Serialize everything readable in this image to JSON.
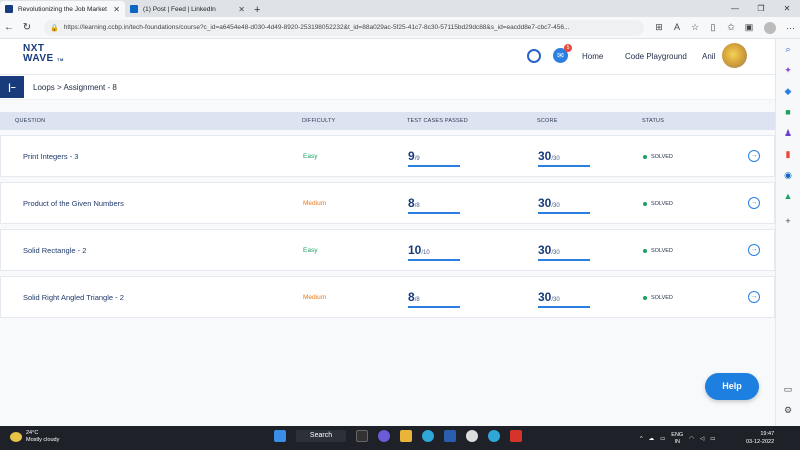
{
  "browser": {
    "tabs": [
      {
        "title": "Revolutionizing the Job Market |",
        "active": true
      },
      {
        "title": "(1) Post | Feed | LinkedIn",
        "active": false
      }
    ],
    "url": "https://learning.ccbp.in/tech-foundations/course?c_id=a6454e48-d030-4d49-8920-253198052232&t_id=88a029ac-5f25-41c7-8c30-57115bd29dc88&s_id=eacdd8e7-cbc7-456..."
  },
  "header": {
    "logo_line1": "NXT",
    "logo_line2": "WAVE",
    "logo_tm": "TM",
    "notification_count": "5",
    "home": "Home",
    "playground": "Code Playground",
    "user": "Anil"
  },
  "breadcrumb": "Loops > Assignment - 8",
  "table": {
    "headers": {
      "question": "QUESTION",
      "difficulty": "DIFFICULTY",
      "tests": "TEST CASES PASSED",
      "score": "SCORE",
      "status": "STATUS"
    },
    "rows": [
      {
        "question": "Print Integers - 3",
        "difficulty": "Easy",
        "diff_color": "#1aa260",
        "tests_passed": "9",
        "tests_total": "/9",
        "score": "30",
        "score_total": "/30",
        "status": "SOLVED"
      },
      {
        "question": "Product of the Given Numbers",
        "difficulty": "Medium",
        "diff_color": "#e67a1c",
        "tests_passed": "8",
        "tests_total": "/8",
        "score": "30",
        "score_total": "/30",
        "status": "SOLVED"
      },
      {
        "question": "Solid Rectangle - 2",
        "difficulty": "Easy",
        "diff_color": "#1aa260",
        "tests_passed": "10",
        "tests_total": "/10",
        "score": "30",
        "score_total": "/30",
        "status": "SOLVED"
      },
      {
        "question": "Solid Right Angled Triangle - 2",
        "difficulty": "Medium",
        "diff_color": "#e67a1c",
        "tests_passed": "8",
        "tests_total": "/8",
        "score": "30",
        "score_total": "/30",
        "status": "SOLVED"
      }
    ]
  },
  "help": "Help",
  "taskbar": {
    "temp": "24°C",
    "weather": "Mostly cloudy",
    "search": "Search",
    "lang1": "ENG",
    "lang2": "IN",
    "time": "19:47",
    "date": "03-12-2022"
  }
}
